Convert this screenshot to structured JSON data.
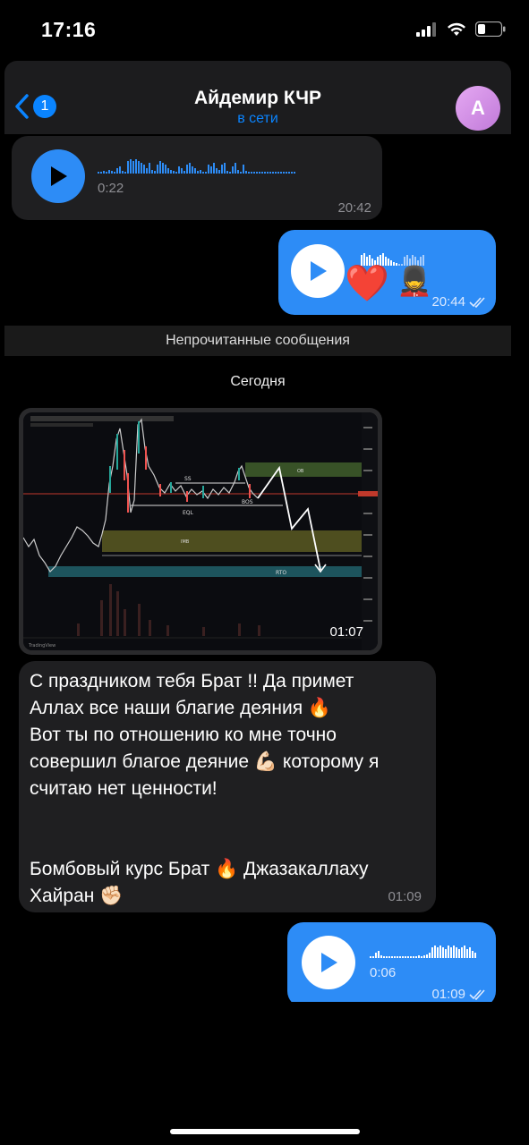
{
  "status_bar": {
    "time": "17:16"
  },
  "header": {
    "back_count": "1",
    "title": "Айдемир КЧР",
    "subtitle": "в сети",
    "avatar_letter": "A"
  },
  "messages": {
    "voice_in": {
      "duration": "0:22",
      "time": "20:42"
    },
    "voice_out_1": {
      "emoji_heart": "❤️",
      "emoji_guard": "💂",
      "time": "20:44"
    },
    "unread_label": "Непрочитанные сообщения",
    "date_label": "Сегодня",
    "chart_image": {
      "time": "01:07",
      "labels": {
        "ss": "SS",
        "eql": "EQL",
        "bos": "BOS",
        "ob": "OB",
        "imb": "IMB",
        "rto": "RTO",
        "brand": "TradingView"
      }
    },
    "text_message": {
      "lines": [
        "С праздником тебя Брат !! Да примет",
        "Аллах все наши благие деяния 🔥",
        "Вот ты по отношению ко мне точно",
        "совершил благое деяние 💪🏻 которому я",
        "считаю нет ценности!",
        "",
        "",
        "Бомбовый курс Брат 🔥 Джазакаллаху",
        "Хайран ✊🏻"
      ],
      "time": "01:09"
    },
    "voice_out_2": {
      "duration": "0:06",
      "time": "01:09"
    }
  },
  "colors": {
    "accent": "#0a84ff",
    "bubble_out": "#2d8cf6",
    "bubble_in": "#1f1f21",
    "avatar": "#d38fe6"
  }
}
